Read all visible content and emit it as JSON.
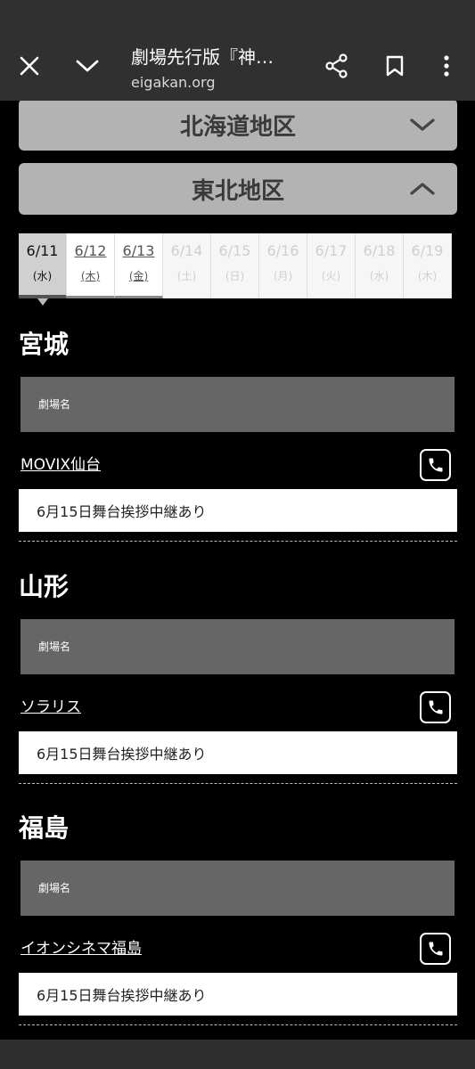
{
  "browser": {
    "title": "劇場先行版『神…",
    "url": "eigakan.org"
  },
  "regions": {
    "hokkaido": "北海道地区",
    "tohoku": "東北地区"
  },
  "dates": [
    {
      "date": "6/11",
      "weekday": "(水)",
      "state": "selected"
    },
    {
      "date": "6/12",
      "weekday": "(木)",
      "state": "available"
    },
    {
      "date": "6/13",
      "weekday": "(金)",
      "state": "available"
    },
    {
      "date": "6/14",
      "weekday": "(土)",
      "state": "disabled"
    },
    {
      "date": "6/15",
      "weekday": "(日)",
      "state": "disabled"
    },
    {
      "date": "6/16",
      "weekday": "(月)",
      "state": "disabled"
    },
    {
      "date": "6/17",
      "weekday": "(火)",
      "state": "disabled"
    },
    {
      "date": "6/18",
      "weekday": "(水)",
      "state": "disabled"
    },
    {
      "date": "6/19",
      "weekday": "(木)",
      "state": "disabled"
    }
  ],
  "prefectures": [
    {
      "name": "宮城",
      "header": "劇場名",
      "theater": "MOVIX仙台",
      "note": "6月15日舞台挨拶中継あり"
    },
    {
      "name": "山形",
      "header": "劇場名",
      "theater": "ソラリス",
      "note": "6月15日舞台挨拶中継あり"
    },
    {
      "name": "福島",
      "header": "劇場名",
      "theater": "イオンシネマ福島",
      "note": "6月15日舞台挨拶中継あり"
    }
  ],
  "icons": {
    "close": "close-icon",
    "collapse": "chevron-down-icon",
    "share": "share-icon",
    "bookmark": "bookmark-icon",
    "menu": "more-vert-icon",
    "phone": "phone-icon"
  }
}
